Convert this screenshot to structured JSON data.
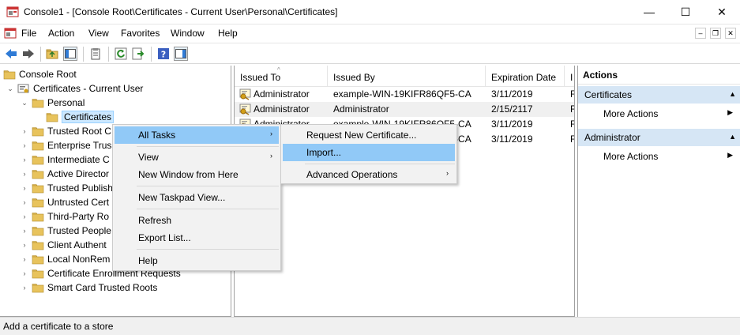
{
  "window": {
    "title": "Console1 - [Console Root\\Certificates - Current User\\Personal\\Certificates]",
    "minimize_glyph": "—",
    "maximize_glyph": "☐",
    "close_glyph": "✕"
  },
  "menubar": {
    "items": [
      "File",
      "Action",
      "View",
      "Favorites",
      "Window",
      "Help"
    ],
    "mdi_minimize": "–",
    "mdi_restore": "❐",
    "mdi_close": "✕"
  },
  "toolbar": {
    "icons": [
      "back-icon",
      "forward-icon",
      "up-folder-icon",
      "show-hide-tree-icon",
      "properties-icon",
      "refresh-icon",
      "export-list-icon",
      "help-icon",
      "show-hide-action-pane-icon"
    ]
  },
  "tree": {
    "items": [
      {
        "label": "Console Root",
        "level": 0,
        "expander": ""
      },
      {
        "label": "Certificates - Current User",
        "level": 1,
        "expander": "⌄"
      },
      {
        "label": "Personal",
        "level": 2,
        "expander": "⌄"
      },
      {
        "label": "Certificates",
        "level": 3,
        "expander": "",
        "selected": true
      },
      {
        "label": "Trusted Root C",
        "level": 2,
        "expander": "›"
      },
      {
        "label": "Enterprise Trus",
        "level": 2,
        "expander": "›"
      },
      {
        "label": "Intermediate C",
        "level": 2,
        "expander": "›"
      },
      {
        "label": "Active Director",
        "level": 2,
        "expander": "›"
      },
      {
        "label": "Trusted Publish",
        "level": 2,
        "expander": "›"
      },
      {
        "label": "Untrusted Cert",
        "level": 2,
        "expander": "›"
      },
      {
        "label": "Third-Party Ro",
        "level": 2,
        "expander": "›"
      },
      {
        "label": "Trusted People",
        "level": 2,
        "expander": "›"
      },
      {
        "label": "Client Authent",
        "level": 2,
        "expander": "›"
      },
      {
        "label": "Local NonRem",
        "level": 2,
        "expander": "›"
      },
      {
        "label": "Certificate Enrollment Requests",
        "level": 2,
        "expander": "›"
      },
      {
        "label": "Smart Card Trusted Roots",
        "level": 2,
        "expander": "›"
      }
    ]
  },
  "list": {
    "columns": [
      "Issued To",
      "Issued By",
      "Expiration Date",
      "I"
    ],
    "sort_indicator": "^",
    "rows": [
      {
        "issued_to": "Administrator",
        "issued_by": "example-WIN-19KIFR86QF5-CA",
        "expiration": "3/11/2019",
        "intended": "F"
      },
      {
        "issued_to": "Administrator",
        "issued_by": "Administrator",
        "expiration": "2/15/2117",
        "intended": "F"
      },
      {
        "issued_to": "Administrator",
        "issued_by": "example-WIN-19KIFR86QF5-CA",
        "expiration": "3/11/2019",
        "intended": "F"
      },
      {
        "issued_to": "Administrator",
        "issued_by": "example-WIN-19KIFR86QF5-CA",
        "expiration": "3/11/2019",
        "intended": "F"
      }
    ]
  },
  "actions": {
    "title": "Actions",
    "sections": [
      {
        "header": "Certificates",
        "items": [
          "More Actions"
        ]
      },
      {
        "header": "Administrator",
        "items": [
          "More Actions"
        ]
      }
    ],
    "collapse_glyph": "▲",
    "arrow_glyph": "▶"
  },
  "context_menu": {
    "items": [
      "All Tasks",
      "View",
      "New Window from Here",
      "New Taskpad View...",
      "Refresh",
      "Export List...",
      "Help"
    ],
    "submenu_glyph": "›"
  },
  "submenu": {
    "items": [
      "Request New Certificate...",
      "Import...",
      "Advanced Operations"
    ]
  },
  "status": {
    "text": "Add a certificate to a store"
  },
  "colors": {
    "highlight": "#91c9f7",
    "selection": "#cce8ff",
    "action_header": "#d6e6f5",
    "folder": "#e8c35c"
  }
}
